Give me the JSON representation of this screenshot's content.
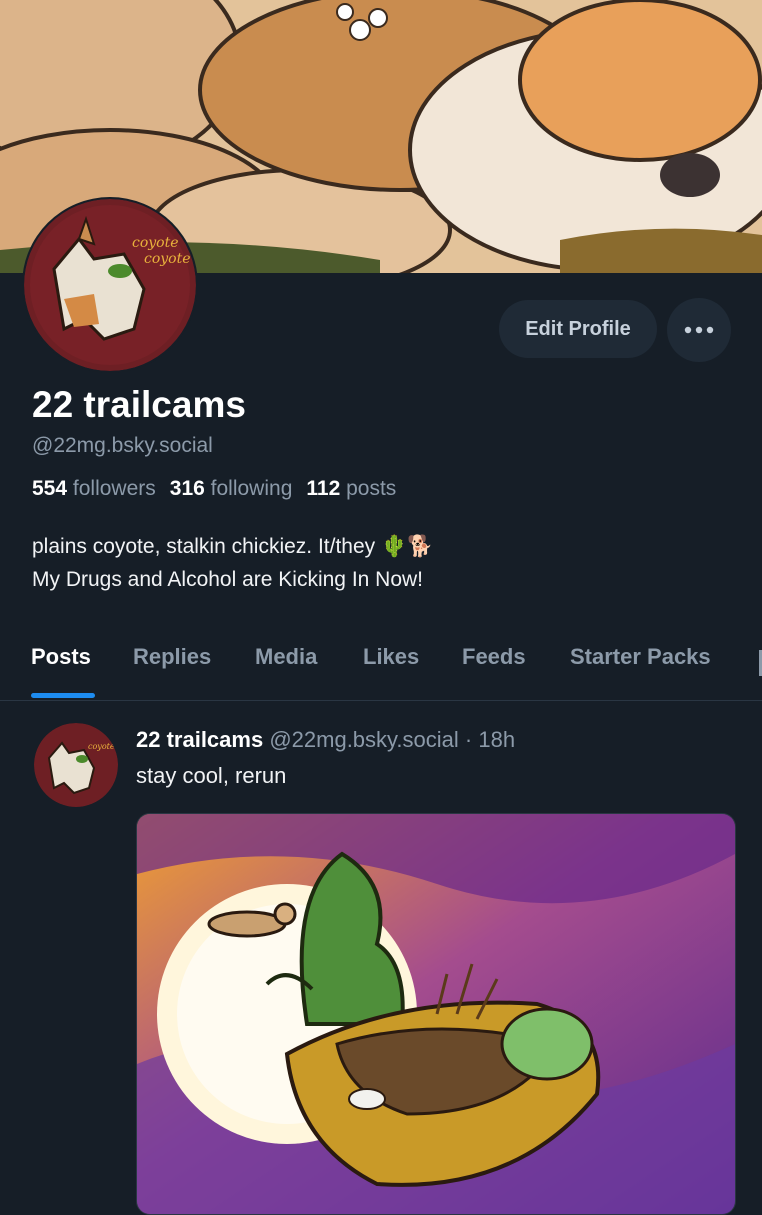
{
  "profile": {
    "display_name": "22 trailcams",
    "handle": "@22mg.bsky.social",
    "followers_count": "554",
    "followers_label": "followers",
    "following_count": "316",
    "following_label": "following",
    "posts_count": "112",
    "posts_label": "posts",
    "bio_line1": "plains coyote, stalkin chickiez. It/they 🌵🐕",
    "bio_line2": "My Drugs and Alcohol are Kicking In Now!",
    "avatar_text": "coyote coyote"
  },
  "actions": {
    "edit_label": "Edit Profile",
    "more_icon": "ellipsis-icon"
  },
  "tabs": [
    {
      "label": "Posts",
      "active": true
    },
    {
      "label": "Replies",
      "active": false
    },
    {
      "label": "Media",
      "active": false
    },
    {
      "label": "Likes",
      "active": false
    },
    {
      "label": "Feeds",
      "active": false
    },
    {
      "label": "Starter Packs",
      "active": false
    }
  ],
  "post": {
    "author": "22 trailcams",
    "handle": "@22mg.bsky.social",
    "separator": "·",
    "time": "18h",
    "text": "stay cool, rerun"
  },
  "colors": {
    "background": "#161e27",
    "accent": "#1d8cf0",
    "muted_text": "#8c9aa9",
    "button_bg": "#1f2a36"
  }
}
